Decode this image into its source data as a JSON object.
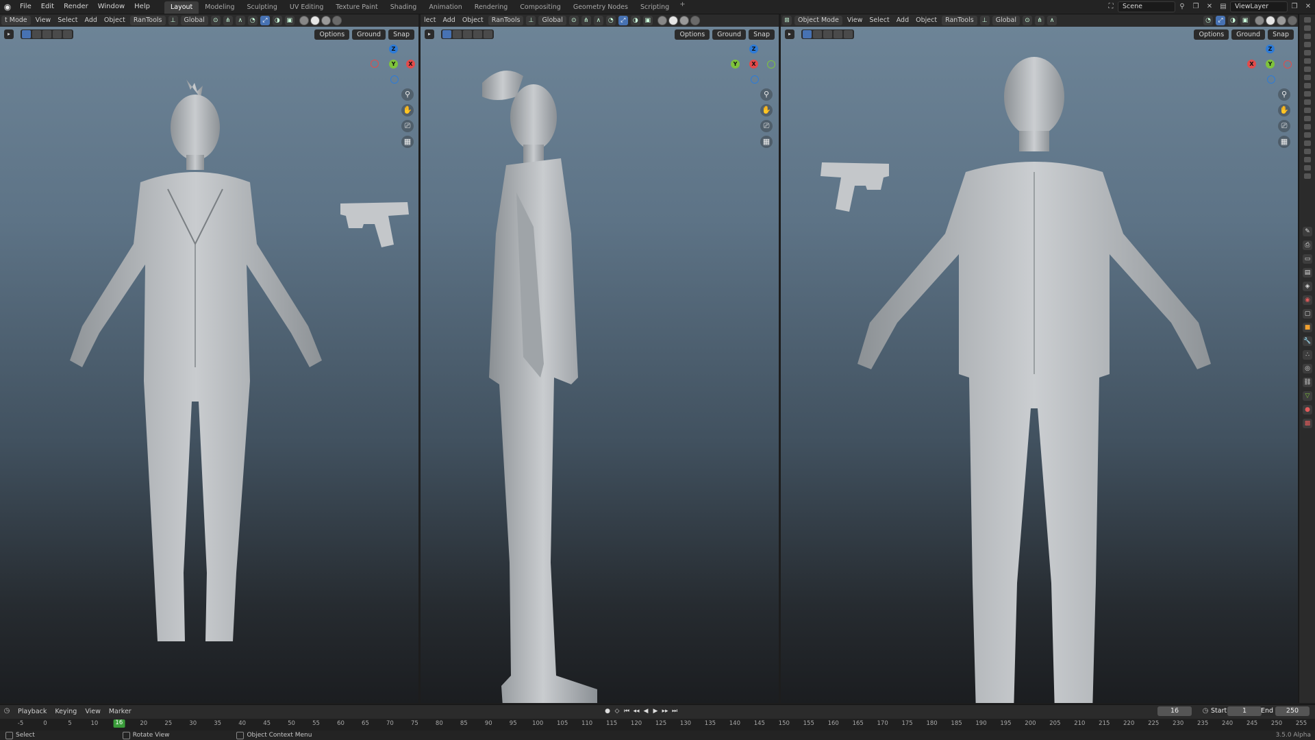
{
  "topbar": {
    "menus": [
      "File",
      "Edit",
      "Render",
      "Window",
      "Help"
    ],
    "workspaces": [
      "Layout",
      "Modeling",
      "Sculpting",
      "UV Editing",
      "Texture Paint",
      "Shading",
      "Animation",
      "Rendering",
      "Compositing",
      "Geometry Nodes",
      "Scripting"
    ],
    "active_workspace": "Layout",
    "add_tab": "+",
    "scene": "Scene",
    "view_layer": "ViewLayer"
  },
  "viewports": [
    {
      "mode": "t Mode",
      "menus": [
        "View",
        "Select",
        "Add",
        "Object"
      ],
      "addon": "RanTools",
      "transform": "Global",
      "options": "Options",
      "ground": "Ground",
      "snap": "Snap",
      "gizmo": {
        "up": "Z",
        "center": "Y",
        "right": "X"
      },
      "view": "front"
    },
    {
      "mode": "lect",
      "menus": [
        "Add",
        "Object"
      ],
      "addon": "RanTools",
      "transform": "Global",
      "options": "Options",
      "ground": "Ground",
      "snap": "Snap",
      "gizmo": {
        "up": "Z",
        "left": "Y",
        "center": "X"
      },
      "view": "side"
    },
    {
      "mode": "Object Mode",
      "menus": [
        "View",
        "Select",
        "Add",
        "Object"
      ],
      "addon": "RanTools",
      "transform": "Global",
      "options": "Options",
      "ground": "Ground",
      "snap": "Snap",
      "gizmo": {
        "up": "Z",
        "left": "X",
        "center": "Y"
      },
      "view": "back"
    }
  ],
  "timeline": {
    "menus": [
      "Playback",
      "Keying",
      "View",
      "Marker"
    ],
    "current_frame": "16",
    "start_label": "Start",
    "start": "1",
    "end_label": "End",
    "end": "250",
    "ruler_ticks": [
      "-5",
      "0",
      "5",
      "10",
      "16",
      "20",
      "25",
      "30",
      "35",
      "40",
      "45",
      "50",
      "55",
      "60",
      "65",
      "70",
      "75",
      "80",
      "85",
      "90",
      "95",
      "100",
      "105",
      "110",
      "115",
      "120",
      "125",
      "130",
      "135",
      "140",
      "145",
      "150",
      "155",
      "160",
      "165",
      "170",
      "175",
      "180",
      "185",
      "190",
      "195",
      "200",
      "205",
      "210",
      "215",
      "220",
      "225",
      "230",
      "235",
      "240",
      "245",
      "250",
      "255"
    ],
    "marker_frame": "16"
  },
  "statusbar": {
    "select": "Select",
    "rotate": "Rotate View",
    "context": "Object Context Menu",
    "version": "3.5.0 Alpha"
  },
  "colors": {
    "accent": "#4772b3",
    "axis_x": "#e24b4b",
    "axis_y": "#7ec33c",
    "axis_z": "#2e7bd6",
    "frame_marker": "#3a9d3a",
    "viewport_top": "#6e8598",
    "viewport_bottom": "#1b1d20"
  }
}
